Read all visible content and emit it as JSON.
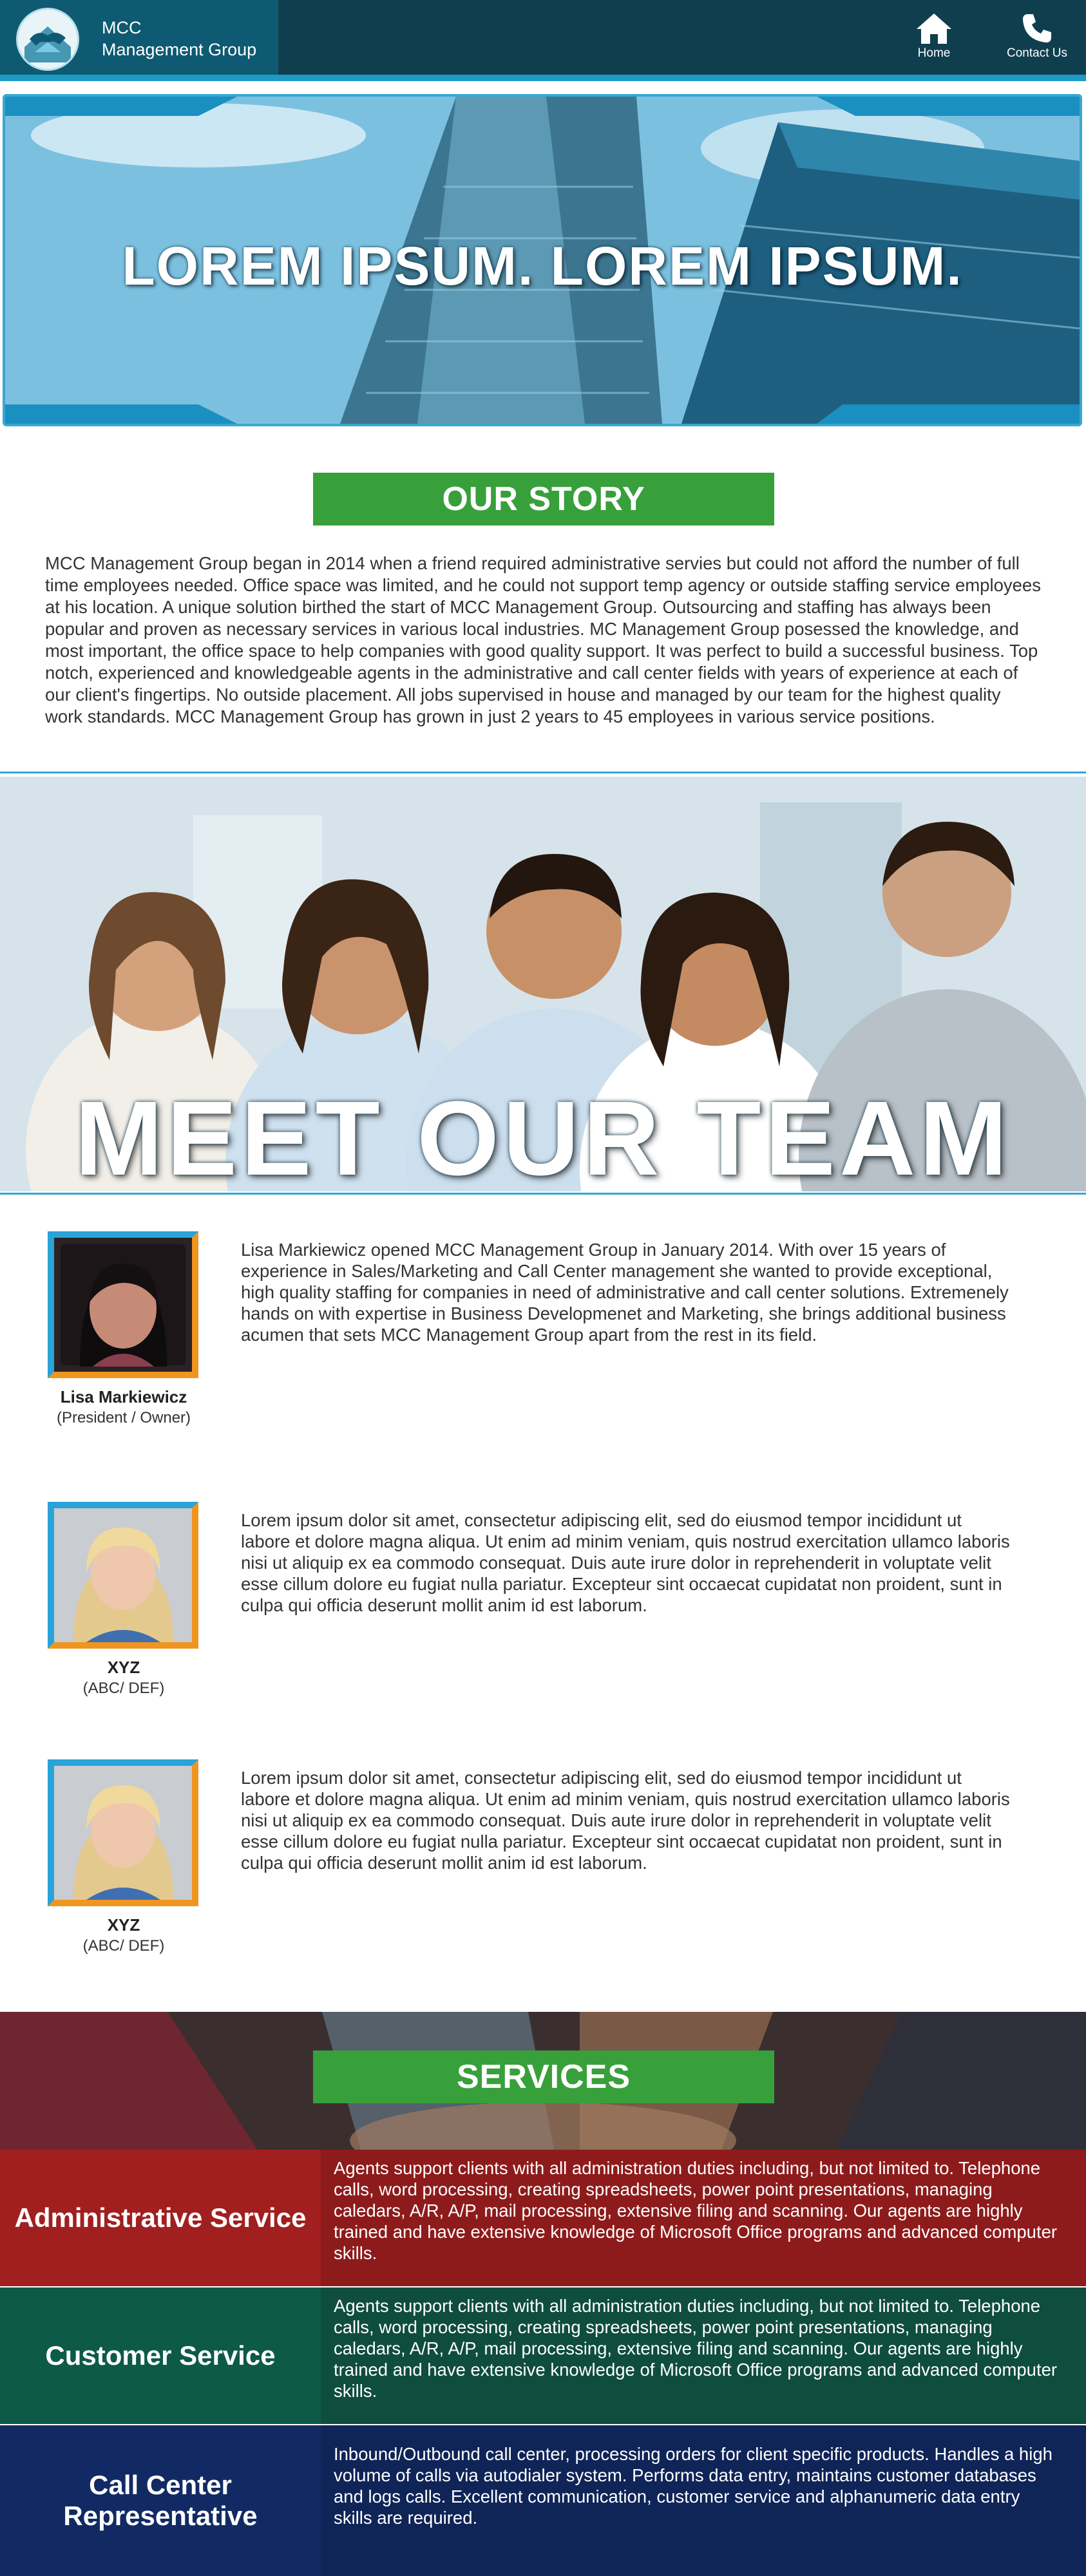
{
  "header": {
    "brand_line1": "MCC",
    "brand_line2": "Management Group",
    "nav": [
      {
        "label": "Home",
        "icon": "home-icon"
      },
      {
        "label": "Contact Us",
        "icon": "phone-icon"
      }
    ]
  },
  "hero": {
    "title": "LOREM IPSUM. LOREM IPSUM."
  },
  "story": {
    "heading": "OUR STORY",
    "text": "MCC Management Group began in 2014 when a friend required administrative servies but could not afford the number of full time employees needed. Office space was limited, and he could not support temp agency or outside staffing service employees at his location. A unique solution birthed the start of MCC Management Group. Outsourcing and staffing has always been popular and proven as necessary services in various local industries. MC Management Group posessed the knowledge, and most important, the office space to help companies with good quality support. It was perfect to build a successful business. Top notch, experienced and knowledgeable agents in the administrative and call center fields with years of experience at each of our client's fingertips. No outside placement. All jobs supervised in house and managed by our team for the highest quality work standards. MCC Management Group has grown in just 2 years to 45 employees in various service positions."
  },
  "team": {
    "title": "MEET OUR TEAM",
    "members": [
      {
        "name": "Lisa Markiewicz",
        "role": "(President / Owner)",
        "bio": "Lisa Markiewicz opened MCC Management Group in January 2014. With over 15 years of experience in Sales/Marketing and Call Center management she wanted to provide exceptional, high quality staffing for companies in need of administrative and call center solutions. Extremenely hands on with expertise in Business Developmenet and Marketing, she brings additional business acumen that sets MCC Management Group apart from the rest in its field."
      },
      {
        "name": "XYZ",
        "role": "(ABC/ DEF)",
        "bio": "Lorem ipsum dolor sit amet, consectetur adipiscing elit, sed do eiusmod tempor incididunt ut labore et dolore magna aliqua. Ut enim ad minim veniam, quis nostrud exercitation ullamco laboris nisi ut aliquip ex ea commodo consequat. Duis aute irure dolor in reprehenderit in voluptate velit esse cillum dolore eu fugiat nulla pariatur. Excepteur sint occaecat cupidatat non proident, sunt in culpa qui officia deserunt mollit anim id est laborum."
      },
      {
        "name": "XYZ",
        "role": "(ABC/ DEF)",
        "bio": "Lorem ipsum dolor sit amet, consectetur adipiscing elit, sed do eiusmod tempor incididunt ut labore et dolore magna aliqua. Ut enim ad minim veniam, quis nostrud exercitation ullamco laboris nisi ut aliquip ex ea commodo consequat. Duis aute irure dolor in reprehenderit in voluptate velit esse cillum dolore eu fugiat nulla pariatur. Excepteur sint occaecat cupidatat non proident, sunt in culpa qui officia deserunt mollit anim id est laborum."
      }
    ]
  },
  "services": {
    "heading": "SERVICES",
    "items": [
      {
        "name": "Administrative Service",
        "color": "#8e1b1b",
        "desc": "Agents support clients with all administration duties including, but not limited to. Telephone calls, word processing, creating spreadsheets, power point presentations, managing caledars, A/R, A/P, mail processing, extensive filing and scanning. Our agents are highly trained and have extensive knowledge of Microsoft Office programs and advanced computer skills."
      },
      {
        "name": "Customer Service",
        "color": "#0f4d3e",
        "desc": "Agents support clients with all administration duties including, but not limited to. Telephone calls, word processing, creating spreadsheets, power point presentations, managing caledars, A/R, A/P, mail processing, extensive filing and scanning. Our agents are highly trained and have extensive knowledge of Microsoft Office programs and advanced computer skills."
      },
      {
        "name_line1": "Call Center",
        "name_line2": "Representative",
        "color": "#0f2457",
        "desc": "Inbound/Outbound call center, processing orders for client specific products. Handles a high volume of calls via autodialer system. Performs data entry, maintains customer databases and logs calls. Excellent communication, customer service and alphanumeric data entry skills are required."
      }
    ]
  }
}
